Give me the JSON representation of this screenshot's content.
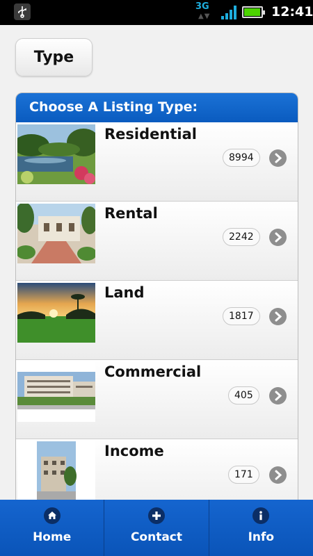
{
  "status_bar": {
    "network": "3G",
    "time": "12:41",
    "icons": [
      "usb-icon",
      "signal-icon",
      "battery-icon"
    ],
    "battery_level": 0.9
  },
  "type_button": {
    "label": "Type"
  },
  "listing": {
    "header": "Choose A Listing Type:",
    "items": [
      {
        "title": "Residential",
        "count": "8994",
        "image": "residential-thumbnail"
      },
      {
        "title": "Rental",
        "count": "2242",
        "image": "rental-thumbnail"
      },
      {
        "title": "Land",
        "count": "1817",
        "image": "land-thumbnail"
      },
      {
        "title": "Commercial",
        "count": "405",
        "image": "commercial-thumbnail"
      },
      {
        "title": "Income",
        "count": "171",
        "image": "income-thumbnail"
      }
    ]
  },
  "bottom_nav": {
    "items": [
      {
        "label": "Home",
        "icon": "home-icon"
      },
      {
        "label": "Contact",
        "icon": "plus-icon"
      },
      {
        "label": "Info",
        "icon": "info-icon"
      }
    ]
  },
  "colors": {
    "accent": "#0a5bbf",
    "status_bar": "#000000",
    "network": "#1eaede",
    "battery": "#4cd400"
  }
}
